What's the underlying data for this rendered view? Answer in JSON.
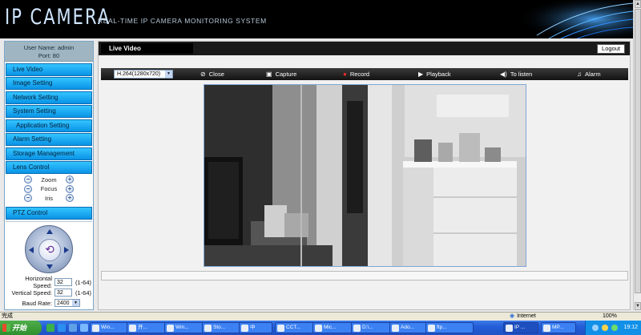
{
  "banner": {
    "logo": "IP CAMERA",
    "subtitle": "REAL-TIME IP CAMERA MONITORING SYSTEM"
  },
  "sidebar": {
    "user_label": "User Name:",
    "user_name": "admin",
    "port_label": "Port:",
    "port": "80",
    "items": [
      {
        "label": "Live Video"
      },
      {
        "label": "Image Setting"
      },
      {
        "label": "Network Setting"
      },
      {
        "label": "System Setting"
      },
      {
        "label": "Application Setting"
      },
      {
        "label": "Alarm Setting"
      },
      {
        "label": "Storage Management"
      },
      {
        "label": "Lens Control"
      }
    ],
    "lens": {
      "zoom": "Zoom",
      "focus": "Focus",
      "iris": "Iris",
      "minus": "−",
      "plus": "+"
    },
    "ptz_title": "PTZ Control",
    "speeds": {
      "horizontal_label": "Horizontal Speed:",
      "horizontal_value": "32",
      "horizontal_range": "(1-64)",
      "vertical_label": "Vertical Speed:",
      "vertical_value": "32",
      "vertical_range": "(1-64)",
      "baud_label": "Baud Rate:",
      "baud_value": "2400"
    }
  },
  "main": {
    "tab_label": "Live Video",
    "logout_label": "Logout",
    "stream_select": "H.264(1280x720)",
    "toolbar": {
      "close": "Close",
      "capture": "Capture",
      "record": "Record",
      "playback": "Playback",
      "listen": "To listen",
      "alarm": "Alarm"
    }
  },
  "statusbar": {
    "done": "完成",
    "zone": "Internet",
    "zoom": "100%"
  },
  "taskbar": {
    "start": "开始",
    "tasks": [
      {
        "label": "Win..."
      },
      {
        "label": "开..."
      },
      {
        "label": "Win..."
      },
      {
        "label": "Sto..."
      },
      {
        "label": "中"
      },
      {
        "label": "CCT..."
      },
      {
        "label": "Mic..."
      },
      {
        "label": "D:\\..."
      },
      {
        "label": "Ado..."
      },
      {
        "label": "ftp..."
      },
      {
        "label": "IP ..."
      },
      {
        "label": "MP..."
      }
    ],
    "clock": "19:12"
  },
  "colors": {
    "nav_blue": "#1fb0f5",
    "banner_bg": "#000000",
    "taskbar_blue": "#245ed8",
    "start_green": "#3a9d36"
  }
}
